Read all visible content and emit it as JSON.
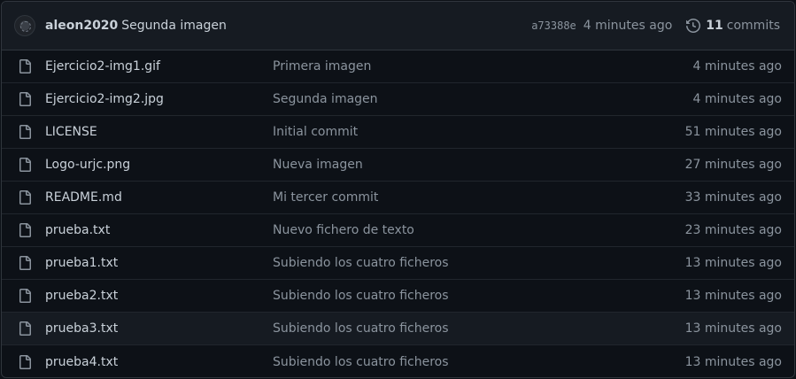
{
  "header": {
    "author": "aleon2020",
    "message": "Segunda imagen",
    "sha": "a73388e",
    "time": "4 minutes ago",
    "commits_count": "11",
    "commits_label": "commits"
  },
  "files": [
    {
      "name": "Ejercicio2-img1.gif",
      "message": "Primera imagen",
      "time": "4 minutes ago"
    },
    {
      "name": "Ejercicio2-img2.jpg",
      "message": "Segunda imagen",
      "time": "4 minutes ago"
    },
    {
      "name": "LICENSE",
      "message": "Initial commit",
      "time": "51 minutes ago"
    },
    {
      "name": "Logo-urjc.png",
      "message": "Nueva imagen",
      "time": "27 minutes ago"
    },
    {
      "name": "README.md",
      "message": "Mi tercer commit",
      "time": "33 minutes ago"
    },
    {
      "name": "prueba.txt",
      "message": "Nuevo fichero de texto",
      "time": "23 minutes ago"
    },
    {
      "name": "prueba1.txt",
      "message": "Subiendo los cuatro ficheros",
      "time": "13 minutes ago"
    },
    {
      "name": "prueba2.txt",
      "message": "Subiendo los cuatro ficheros",
      "time": "13 minutes ago"
    },
    {
      "name": "prueba3.txt",
      "message": "Subiendo los cuatro ficheros",
      "time": "13 minutes ago"
    },
    {
      "name": "prueba4.txt",
      "message": "Subiendo los cuatro ficheros",
      "time": "13 minutes ago"
    }
  ],
  "icons": {
    "file": "file-icon",
    "history": "history-icon",
    "avatar": "avatar"
  },
  "colors": {
    "background": "#0d1117",
    "header_background": "#161b22",
    "border": "#30363d",
    "text": "#c9d1d9",
    "muted": "#8b949e"
  }
}
